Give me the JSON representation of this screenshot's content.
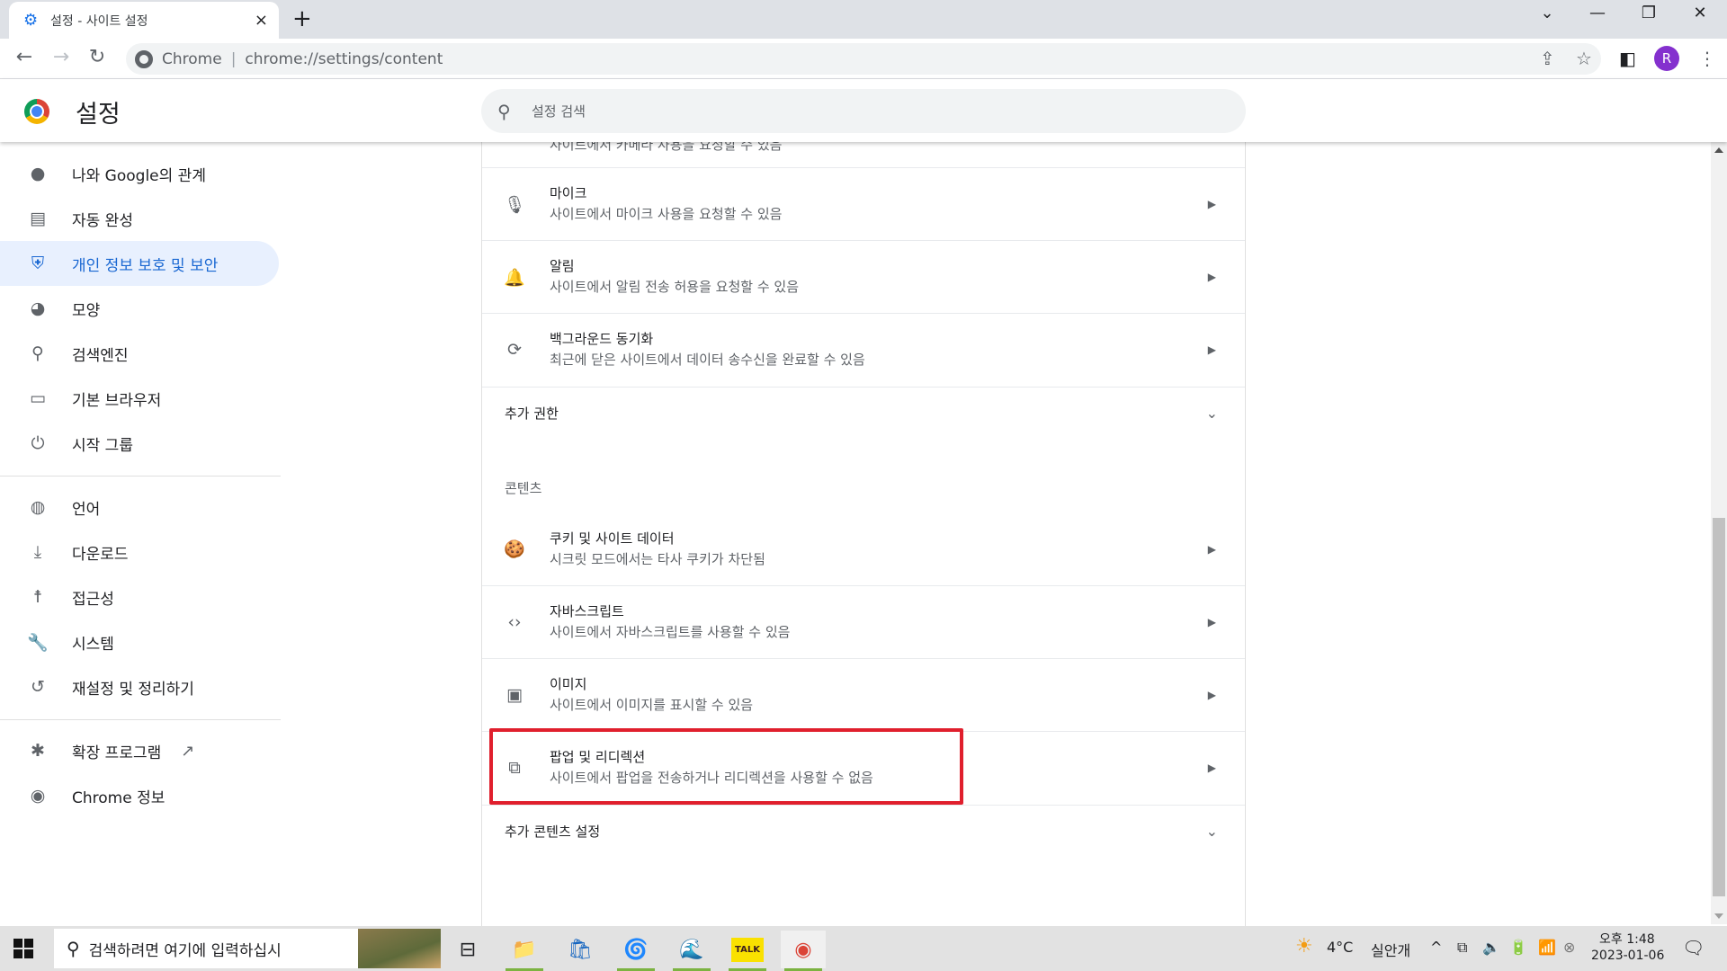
{
  "browser": {
    "tab": {
      "icon": "gear-icon",
      "title": "설정 - 사이트 설정",
      "close_label": "×"
    },
    "new_tab_label": "+",
    "window_controls": {
      "tab_search": "⌄",
      "minimize": "—",
      "restore": "❐",
      "close": "✕"
    },
    "nav": {
      "back": "←",
      "forward": "→",
      "reload": "↻"
    },
    "omnibox": {
      "site_name": "Chrome",
      "separator": "|",
      "url": "chrome://settings/content"
    },
    "toolbar_icons": {
      "share": "⇪",
      "bookmark": "☆",
      "side_panel": "◧",
      "menu": "⋮"
    },
    "profile_initial": "R"
  },
  "settings": {
    "title": "설정",
    "search_placeholder": "설정 검색",
    "search_value": ""
  },
  "sidebar": {
    "items": [
      {
        "icon": "person-icon",
        "glyph": "👤",
        "label": "나와 Google의 관계",
        "active": false
      },
      {
        "icon": "clipboard-icon",
        "glyph": "📋",
        "label": "자동 완성",
        "active": false
      },
      {
        "icon": "shield-icon",
        "glyph": "🛡",
        "label": "개인 정보 보호 및 보안",
        "active": true
      },
      {
        "icon": "palette-icon",
        "glyph": "🎨",
        "label": "모양",
        "active": false
      },
      {
        "icon": "search-icon",
        "glyph": "🔍",
        "label": "검색엔진",
        "active": false
      },
      {
        "icon": "browser-window-icon",
        "glyph": "▭",
        "label": "기본 브라우저",
        "active": false
      },
      {
        "icon": "power-icon",
        "glyph": "⏻",
        "label": "시작 그룹",
        "active": false
      },
      {
        "icon": "globe-icon",
        "glyph": "🌐",
        "label": "언어",
        "active": false
      },
      {
        "icon": "download-icon",
        "glyph": "⤓",
        "label": "다운로드",
        "active": false
      },
      {
        "icon": "accessibility-icon",
        "glyph": "♿",
        "label": "접근성",
        "active": false
      },
      {
        "icon": "wrench-icon",
        "glyph": "🔧",
        "label": "시스템",
        "active": false
      },
      {
        "icon": "history-icon",
        "glyph": "↺",
        "label": "재설정 및 정리하기",
        "active": false
      },
      {
        "icon": "puzzle-icon",
        "glyph": "🧩",
        "label": "확장 프로그램",
        "active": false,
        "external": "↗"
      },
      {
        "icon": "chrome-icon",
        "glyph": "◉",
        "label": "Chrome 정보",
        "active": false
      }
    ]
  },
  "content": {
    "clipped_row_subtitle": "사이트에서 카메라 사용을 요청할 수 있음",
    "permission_rows": [
      {
        "icon": "microphone-icon",
        "glyph": "🎙",
        "title": "마이크",
        "subtitle": "사이트에서 마이크 사용을 요청할 수 있음"
      },
      {
        "icon": "bell-icon",
        "glyph": "🔔",
        "title": "알림",
        "subtitle": "사이트에서 알림 전송 허용을 요청할 수 있음"
      },
      {
        "icon": "sync-icon",
        "glyph": "⟳",
        "title": "백그라운드 동기화",
        "subtitle": "최근에 닫은 사이트에서 데이터 송수신을 완료할 수 있음"
      }
    ],
    "additional_permissions_label": "추가 권한",
    "content_section_title": "콘텐츠",
    "content_rows": [
      {
        "icon": "cookie-icon",
        "glyph": "🍪",
        "title": "쿠키 및 사이트 데이터",
        "subtitle": "시크릿 모드에서는 타사 쿠키가 차단됨"
      },
      {
        "icon": "code-icon",
        "glyph": "‹›",
        "title": "자바스크립트",
        "subtitle": "사이트에서 자바스크립트를 사용할 수 있음"
      },
      {
        "icon": "image-icon",
        "glyph": "🖼",
        "title": "이미지",
        "subtitle": "사이트에서 이미지를 표시할 수 있음"
      },
      {
        "icon": "open-in-new-icon",
        "glyph": "↗",
        "title": "팝업 및 리디렉션",
        "subtitle": "사이트에서 팝업을 전송하거나 리디렉션을 사용할 수 없음",
        "highlighted": true
      }
    ],
    "additional_content_label": "추가 콘텐츠 설정",
    "arrow_glyph": "▶",
    "chevron_glyph": "⌄",
    "highlight_color": "#e01f2d"
  },
  "scrollbar": {
    "position_fraction": 1.0,
    "thumb_start_fraction": 0.48,
    "thumb_end_fraction": 0.985
  },
  "taskbar": {
    "search_placeholder": "검색하려면 여기에 입력하십시",
    "apps": [
      {
        "name": "task-view",
        "glyph": "⊟",
        "running": false
      },
      {
        "name": "file-explorer",
        "glyph": "📁",
        "running": true
      },
      {
        "name": "microsoft-store",
        "glyph": "🛍",
        "running": false
      },
      {
        "name": "edge",
        "glyph": "🌀",
        "running": true
      },
      {
        "name": "app-swirl",
        "glyph": "🌊",
        "running": true
      },
      {
        "name": "kakaotalk",
        "glyph": "TALK",
        "running": true
      },
      {
        "name": "chrome",
        "glyph": "◉",
        "running": true
      }
    ],
    "weather": {
      "temp": "4°C",
      "desc": "실안개"
    },
    "tray_icons": [
      "^",
      "⧉",
      "🔈",
      "🔋",
      "📶",
      "⊗"
    ],
    "time": "오후 1:48",
    "date": "2023-01-06",
    "notification_glyph": "🗨"
  }
}
